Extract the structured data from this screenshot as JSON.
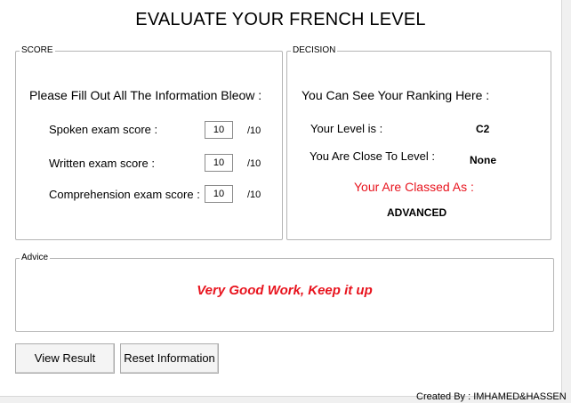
{
  "title": "EVALUATE YOUR FRENCH LEVEL",
  "score": {
    "label": "SCORE",
    "instruction": "Please Fill Out All The Information Bleow :",
    "rows": [
      {
        "label": "Spoken exam score :",
        "value": "10",
        "suffix": "/10"
      },
      {
        "label": "Written exam score :",
        "value": "10",
        "suffix": "/10"
      },
      {
        "label": "Comprehension exam score :",
        "value": "10",
        "suffix": "/10"
      }
    ]
  },
  "decision": {
    "label": "DECISION",
    "heading": "You Can See Your Ranking Here :",
    "level_label": "Your Level is  :",
    "level_value": "C2",
    "close_label": "You Are Close To Level :",
    "close_value": "None",
    "classed_label": "Your Are Classed As :",
    "classed_value": "ADVANCED"
  },
  "advice": {
    "label": "Advice",
    "message": "Very Good Work, Keep it up"
  },
  "buttons": {
    "view_result": "View Result",
    "reset_information": "Reset Information"
  },
  "footer": "Created By : IMHAMED&HASSEN",
  "colors": {
    "highlight_red": "#e8141e",
    "background": "#f0f0f0",
    "panel": "#ffffff"
  }
}
